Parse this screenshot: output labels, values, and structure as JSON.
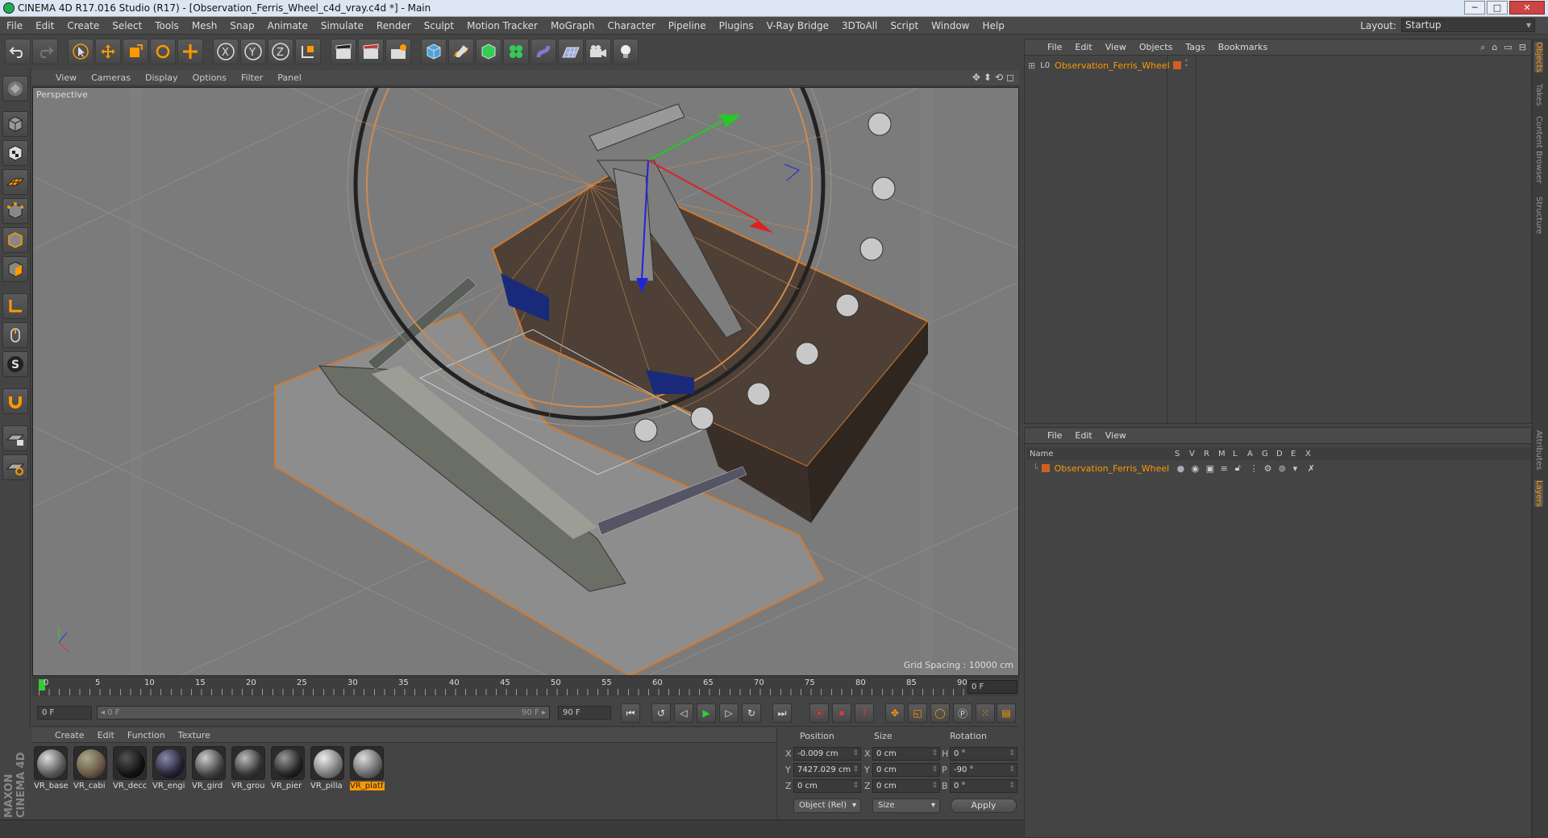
{
  "window": {
    "title": "CINEMA 4D R17.016 Studio (R17) - [Observation_Ferris_Wheel_c4d_vray.c4d *] - Main",
    "minimize": "─",
    "maximize": "□",
    "close": "✕"
  },
  "menu": [
    "File",
    "Edit",
    "Create",
    "Select",
    "Tools",
    "Mesh",
    "Snap",
    "Animate",
    "Simulate",
    "Render",
    "Sculpt",
    "Motion Tracker",
    "MoGraph",
    "Character",
    "Pipeline",
    "Plugins",
    "V-Ray Bridge",
    "3DToAll",
    "Script",
    "Window",
    "Help"
  ],
  "layout": {
    "label": "Layout:",
    "value": "Startup"
  },
  "viewport": {
    "menu": [
      "View",
      "Cameras",
      "Display",
      "Options",
      "Filter",
      "Panel"
    ],
    "label": "Perspective",
    "grid_spacing": "Grid Spacing : 10000 cm"
  },
  "timeline": {
    "ticks": [
      "0",
      "5",
      "10",
      "15",
      "20",
      "25",
      "30",
      "35",
      "40",
      "45",
      "50",
      "55",
      "60",
      "65",
      "70",
      "75",
      "80",
      "85",
      "90"
    ],
    "current_frame": "0 F"
  },
  "playback": {
    "start": "0 F",
    "slider_left": "◂ 0 F",
    "slider_right": "90 F ▸",
    "end": "90 F"
  },
  "materials": {
    "menu": [
      "Create",
      "Edit",
      "Function",
      "Texture"
    ],
    "items": [
      {
        "name": "VR_base"
      },
      {
        "name": "VR_cabi"
      },
      {
        "name": "VR_decc"
      },
      {
        "name": "VR_engi"
      },
      {
        "name": "VR_gird"
      },
      {
        "name": "VR_grou"
      },
      {
        "name": "VR_pier"
      },
      {
        "name": "VR_pilla"
      },
      {
        "name": "VR_platf"
      }
    ]
  },
  "coordinates": {
    "headers": {
      "position": "Position",
      "size": "Size",
      "rotation": "Rotation"
    },
    "rows": [
      {
        "axis": "X",
        "pos": "-0.009 cm",
        "size_axis": "X",
        "size": "0 cm",
        "rot_axis": "H",
        "rot": "0 °"
      },
      {
        "axis": "Y",
        "pos": "7427.029 cm",
        "size_axis": "Y",
        "size": "0 cm",
        "rot_axis": "P",
        "rot": "-90 °"
      },
      {
        "axis": "Z",
        "pos": "0 cm",
        "size_axis": "Z",
        "size": "0 cm",
        "rot_axis": "B",
        "rot": "0 °"
      }
    ],
    "mode": "Object (Rel)",
    "size_mode": "Size",
    "apply": "Apply"
  },
  "objects": {
    "menu": [
      "File",
      "Edit",
      "View",
      "Objects",
      "Tags",
      "Bookmarks"
    ],
    "items": [
      {
        "name": "Observation_Ferris_Wheel"
      }
    ]
  },
  "layers": {
    "menu": [
      "File",
      "Edit",
      "View"
    ],
    "name_header": "Name",
    "columns": [
      "S",
      "V",
      "R",
      "M",
      "L",
      "A",
      "G",
      "D",
      "E",
      "X"
    ],
    "items": [
      {
        "name": "Observation_Ferris_Wheel"
      }
    ]
  },
  "side_tabs": [
    "Objects",
    "Takes",
    "Content Browser",
    "Structure",
    "Attributes",
    "Layers"
  ],
  "brand": "MAXON CINEMA 4D",
  "colors": {
    "accent": "#ff9900",
    "viewport_bg": "#7b7b7b",
    "ui_bg": "#444444"
  }
}
